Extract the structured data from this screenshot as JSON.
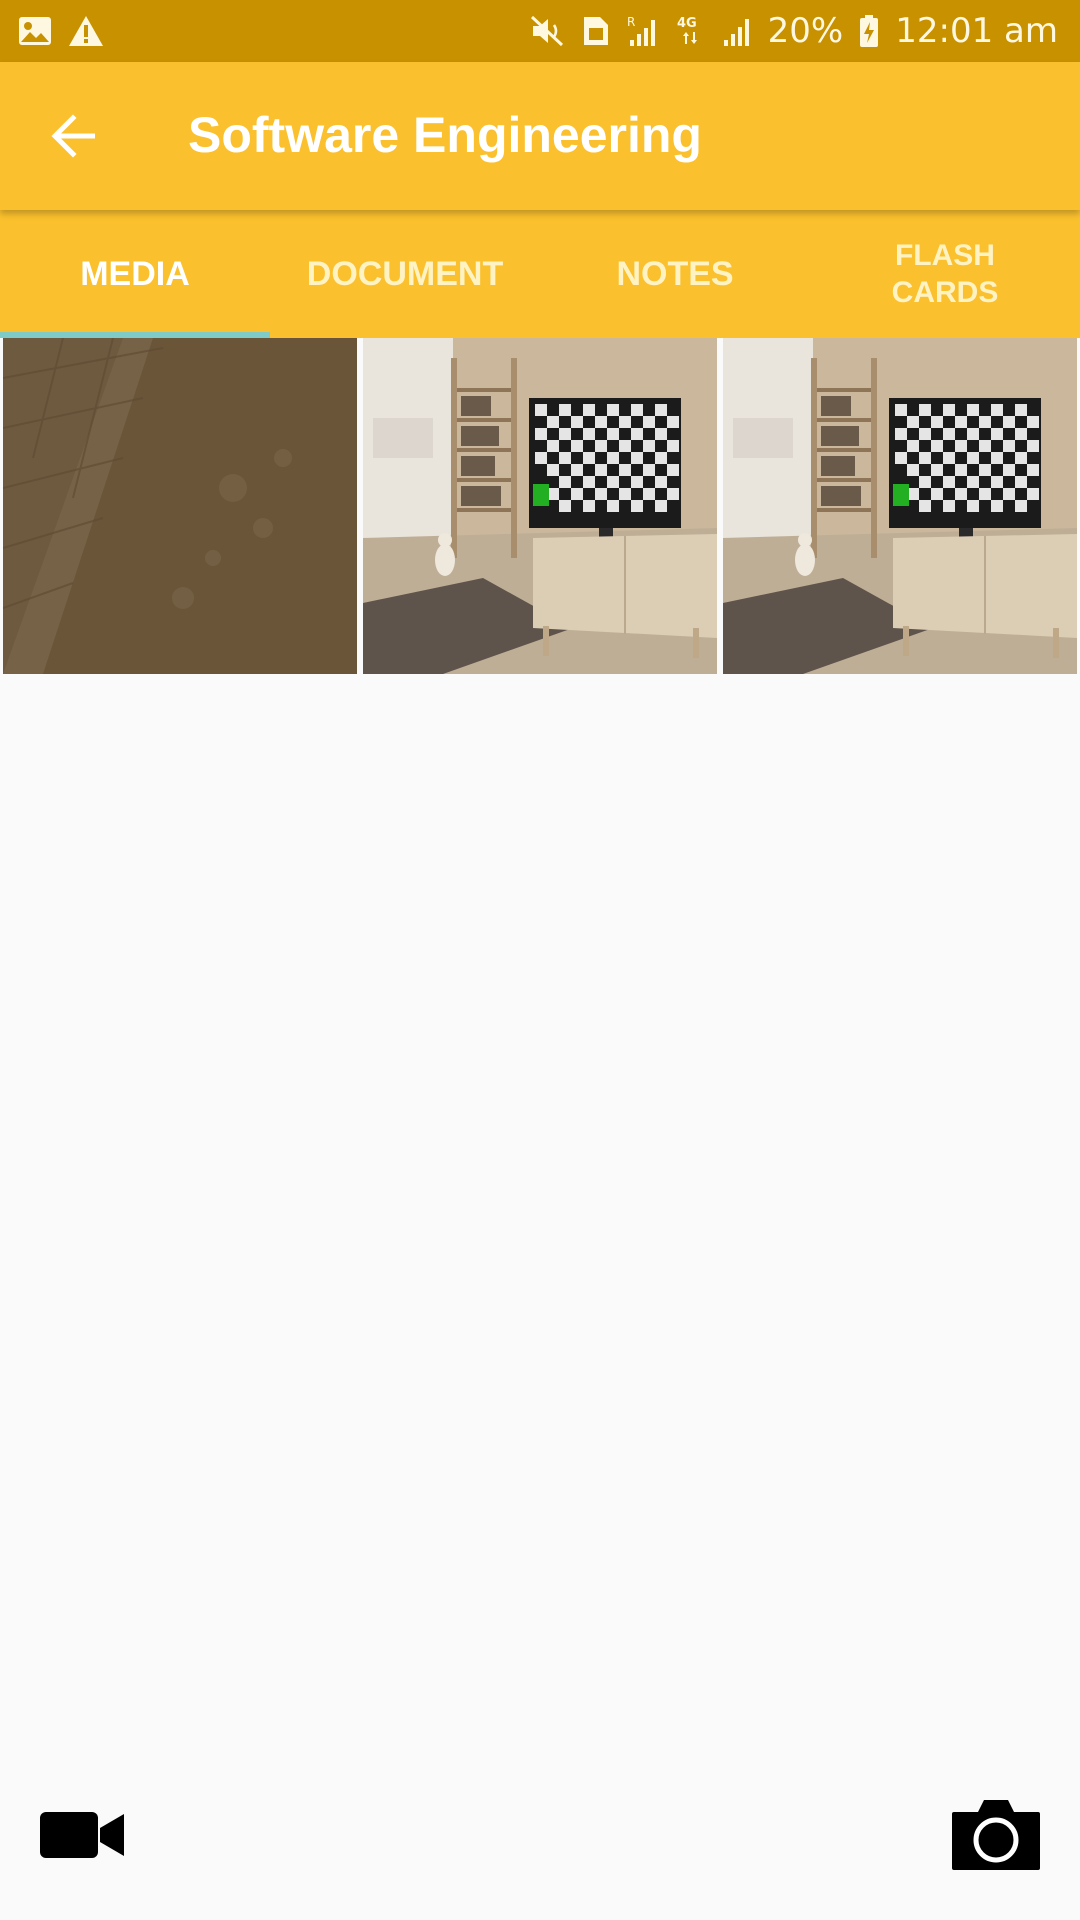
{
  "status_bar": {
    "icons": [
      "image-icon",
      "warning-icon",
      "mute-icon",
      "sim-icon",
      "roaming-signal-icon",
      "4g-icon",
      "signal-icon",
      "battery-icon"
    ],
    "roaming_label": "R",
    "network_label": "4G",
    "battery": "20%",
    "time": "12:01 am"
  },
  "app_bar": {
    "title": "Software Engineering",
    "back_icon": "arrow-left-icon"
  },
  "tabs": [
    {
      "label": "MEDIA",
      "active": true
    },
    {
      "label": "DOCUMENT",
      "active": false
    },
    {
      "label": "NOTES",
      "active": false
    },
    {
      "label": "FLASH\nCARDS",
      "active": false
    }
  ],
  "media": [
    {
      "kind": "wood-texture"
    },
    {
      "kind": "room-with-tv"
    },
    {
      "kind": "room-with-tv"
    }
  ],
  "actions": {
    "video_icon": "video-camera-icon",
    "photo_icon": "camera-icon"
  },
  "colors": {
    "status_bar": "#c79100",
    "app_bar": "#fbc02d",
    "tab_indicator": "#7ecbc8",
    "background": "#fafafa"
  }
}
